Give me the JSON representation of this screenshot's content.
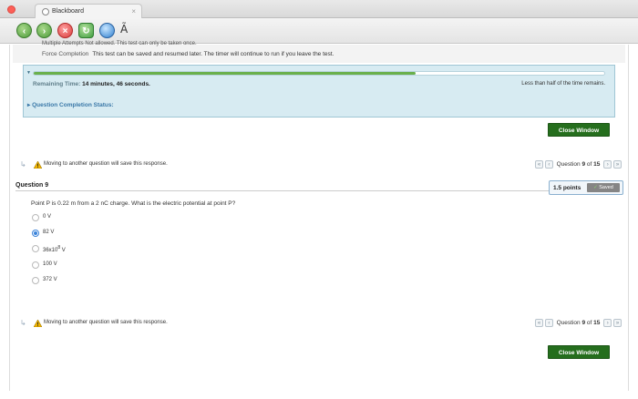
{
  "browser": {
    "tab_title": "Blackboard",
    "toolbar_glyph": "Ã"
  },
  "test_info": {
    "cut_text": "Multiple Attempts  Not allowed. This test can only be taken once.",
    "force_completion_label": "Force Completion",
    "force_completion_text": "This test can be saved and resumed later. The timer will continue to run if you leave the test."
  },
  "timer": {
    "label": "Remaining Time:",
    "value": "14 minutes, 46 seconds.",
    "note": "Less than half of the time remains.",
    "progress_fraction": 0.67,
    "completion_status_label": "Question Completion Status:"
  },
  "buttons": {
    "close_window": "Close Window"
  },
  "navigation": {
    "message": "Moving to another question will save this response.",
    "first": "«",
    "prev": "‹",
    "next": "›",
    "last": "»",
    "question_word": "Question",
    "current": "9",
    "of_word": "of",
    "total": "15"
  },
  "question": {
    "title": "Question 9",
    "points": "1.5 points",
    "saved_label": "Saved",
    "text": "Point P is 0.22 m from a 2 nC charge. What is the electric potential at point P?",
    "options": [
      {
        "label": "0 V",
        "selected": false
      },
      {
        "label": "82 V",
        "selected": true
      },
      {
        "label": "36x10",
        "sup": "8",
        "unit": " V",
        "selected": false
      },
      {
        "label": "100 V",
        "selected": false
      },
      {
        "label": "372 V",
        "selected": false
      }
    ]
  },
  "colors": {
    "close_button": "#256e1d",
    "timer_box": "#d7ebf2",
    "progress_fill": "#6ab04c",
    "selected_radio": "#3b83d9"
  }
}
